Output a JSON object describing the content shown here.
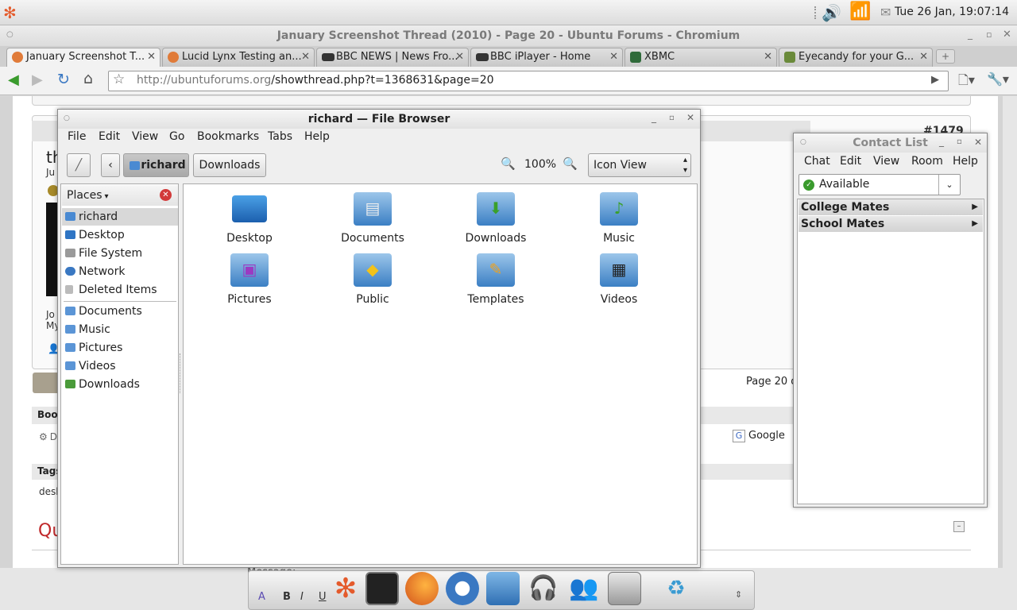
{
  "panel": {
    "clock": "Tue 26 Jan, 19:07:14"
  },
  "browser": {
    "window_title": "January Screenshot Thread (2010) - Page 20 - Ubuntu Forums - Chromium",
    "tabs": [
      {
        "label": "January Screenshot T...",
        "active": true
      },
      {
        "label": "Lucid Lynx Testing an...",
        "active": false
      },
      {
        "label": "BBC NEWS | News Fro...",
        "active": false
      },
      {
        "label": "BBC iPlayer - Home",
        "active": false
      },
      {
        "label": "XBMC",
        "active": false
      },
      {
        "label": "Eyecandy for your G...",
        "active": false
      }
    ],
    "url_host": "http://ubuntuforums.org",
    "url_path": "/showthread.php?t=1368631&page=20"
  },
  "forum": {
    "post_number": "#1479",
    "page_label": "Page 20 o",
    "google": "Google",
    "bookmarks_label": "Book",
    "tags_label": "Tags",
    "tags_value": "desl",
    "quick_label": "Qu",
    "message_label": "Message:",
    "left_frag_1": "th",
    "left_frag_2": "Ju",
    "left_frag_3": "Jo",
    "left_frag_4": "My",
    "left_frag_5": "D"
  },
  "file_browser": {
    "title": "richard — File Browser",
    "menu": [
      "File",
      "Edit",
      "View",
      "Go",
      "Bookmarks",
      "Tabs",
      "Help"
    ],
    "path_current": "richard",
    "path_next": "Downloads",
    "zoom": "100%",
    "view_mode": "Icon View",
    "places_label": "Places",
    "places": [
      "richard",
      "Desktop",
      "File System",
      "Network",
      "Deleted Items"
    ],
    "bookmarks": [
      "Documents",
      "Music",
      "Pictures",
      "Videos",
      "Downloads"
    ],
    "items": [
      "Desktop",
      "Documents",
      "Downloads",
      "Music",
      "Pictures",
      "Public",
      "Templates",
      "Videos"
    ]
  },
  "contact_list": {
    "title": "Contact List",
    "menu": [
      "Chat",
      "Edit",
      "View",
      "Room",
      "Help"
    ],
    "status": "Available",
    "groups": [
      "College Mates",
      "School Mates"
    ]
  },
  "colors": {
    "accent": "#3b7fc4",
    "status_green": "#3a9b2d",
    "close_red": "#d23a3a"
  }
}
